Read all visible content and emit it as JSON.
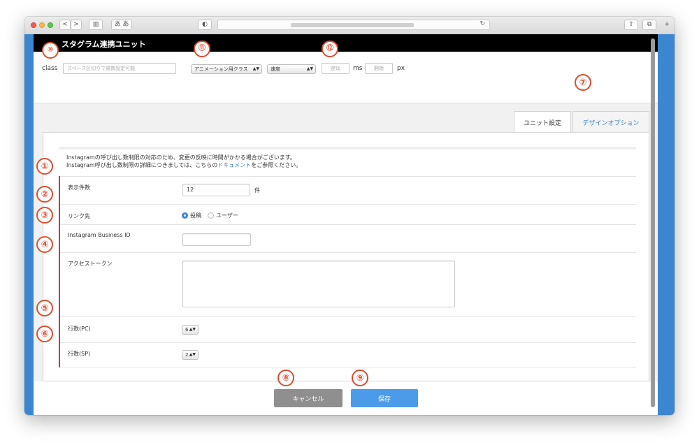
{
  "window": {
    "nav_back": "<",
    "nav_forward": ">",
    "sidebar_glyph": "▥",
    "reader_glyph": "あ あ",
    "privacy_glyph": "◐",
    "reload_glyph": "↻",
    "share_glyph": "⇪",
    "tabs_glyph": "⧉",
    "plus_glyph": "+"
  },
  "unit_header": {
    "title": "スタグラム連携ユニット"
  },
  "top_settings": {
    "class_label": "class",
    "class_placeholder": "スペース区切りで複数設定可能",
    "animation_select": "アニメーション用クラス",
    "speed_select": "速度",
    "delay_placeholder": "遅延",
    "ms_label": "ms",
    "start_placeholder": "開始",
    "px_label": "px"
  },
  "tabs": [
    {
      "label": "ユニット設定"
    },
    {
      "label": "デザインオプション"
    }
  ],
  "notice": {
    "line1": "Instagramの呼び出し数制限の対応のため、変更の反映に時間がかかる場合がございます。",
    "line2_before": "Instagram呼び出し数制限の詳細につきましては、こちらの",
    "line2_link": "ドキュメント",
    "line2_after": "をご参照ください。"
  },
  "form": {
    "count_label": "表示件数",
    "count_value": "12",
    "count_unit": "件",
    "link_label": "リンク先",
    "link_option_post": "投稿",
    "link_option_user": "ユーザー",
    "link_selected": "投稿",
    "business_id_label": "Instagram Business ID",
    "business_id_value": "",
    "token_label": "アクセストークン",
    "token_value": "",
    "rows_pc_label": "行数(PC)",
    "rows_pc_value": "6",
    "rows_sp_label": "行数(SP)",
    "rows_sp_value": "2"
  },
  "footer": {
    "cancel_label": "キャンセル",
    "save_label": "保存"
  },
  "annotations": [
    "①",
    "②",
    "③",
    "④",
    "⑤",
    "⑥",
    "⑦",
    "⑧",
    "⑨",
    "⑩",
    "⑪",
    "⑫"
  ],
  "colors": {
    "accent_blue": "#3c86d1",
    "annotation_orange": "#e34c2d",
    "required_red": "#d7372e",
    "save_button": "#4c9be8",
    "cancel_button": "#8f8f8f"
  }
}
